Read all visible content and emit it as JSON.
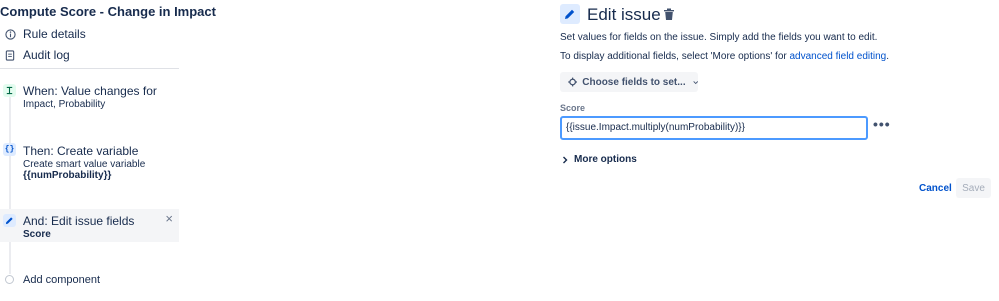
{
  "rule": {
    "title": "Compute Score - Change in Impact",
    "nav": [
      {
        "label": "Rule details",
        "icon": "info-icon"
      },
      {
        "label": "Audit log",
        "icon": "document-icon"
      }
    ]
  },
  "components": {
    "trigger": {
      "title": "When: Value changes for",
      "detail": "Impact, Probability",
      "icon": "trigger-icon"
    },
    "variable": {
      "title": "Then: Create variable",
      "detail": "Create smart value variable",
      "detail_bold": "{{numProbability}}",
      "icon": "smart-value-icon"
    },
    "edit": {
      "title": "And: Edit issue fields",
      "detail_bold": "Score",
      "icon": "pencil-icon"
    },
    "add_label": "Add component"
  },
  "editor": {
    "title": "Edit issue",
    "description": "Set values for fields on the issue. Simply add the fields you want to edit.",
    "more_fields_text": "To display additional fields, select 'More options' for ",
    "more_fields_link": "advanced field editing",
    "more_fields_suffix": ".",
    "choose_fields_label": "Choose fields to set...",
    "field_label": "Score",
    "field_value": "{{issue.Impact.multiply(numProbability)}}",
    "more_options_label": "More options",
    "cancel_label": "Cancel",
    "save_label": "Save"
  },
  "colors": {
    "accent": "#0052cc",
    "focus_border": "#4c9aff",
    "trigger_badge": "#e3fcef",
    "variable_badge": "#deebff"
  }
}
